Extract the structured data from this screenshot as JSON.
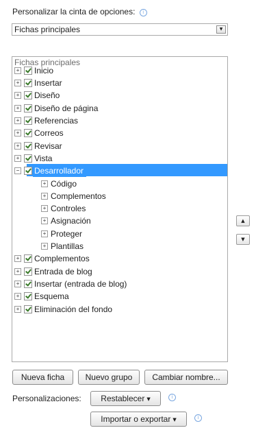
{
  "customize_label": "Personalizar la cinta de opciones:",
  "combo_value": "Fichas principales",
  "tree": {
    "header": "Fichas principales",
    "items": [
      {
        "label": "Inicio",
        "level": 0,
        "expander": "+"
      },
      {
        "label": "Insertar",
        "level": 0,
        "expander": "+"
      },
      {
        "label": "Diseño",
        "level": 0,
        "expander": "+"
      },
      {
        "label": "Diseño de página",
        "level": 0,
        "expander": "+"
      },
      {
        "label": "Referencias",
        "level": 0,
        "expander": "+"
      },
      {
        "label": "Correos",
        "level": 0,
        "expander": "+"
      },
      {
        "label": "Revisar",
        "level": 0,
        "expander": "+"
      },
      {
        "label": "Vista",
        "level": 0,
        "expander": "+"
      },
      {
        "label": "Desarrollador",
        "level": 0,
        "expander": "−",
        "selected": true
      },
      {
        "label": "Código",
        "level": 1,
        "expander": "+"
      },
      {
        "label": "Complementos",
        "level": 1,
        "expander": "+"
      },
      {
        "label": "Controles",
        "level": 1,
        "expander": "+"
      },
      {
        "label": "Asignación",
        "level": 1,
        "expander": "+"
      },
      {
        "label": "Proteger",
        "level": 1,
        "expander": "+"
      },
      {
        "label": "Plantillas",
        "level": 1,
        "expander": "+"
      },
      {
        "label": "Complementos",
        "level": 0,
        "expander": "+"
      },
      {
        "label": "Entrada de blog",
        "level": 0,
        "expander": "+"
      },
      {
        "label": "Insertar (entrada de blog)",
        "level": 0,
        "expander": "+"
      },
      {
        "label": "Esquema",
        "level": 0,
        "expander": "+"
      },
      {
        "label": "Eliminación del fondo",
        "level": 0,
        "expander": "+"
      }
    ]
  },
  "move_up_icon": "triangle-up-icon",
  "move_down_icon": "triangle-down-icon",
  "buttons": {
    "new_tab": "Nueva ficha",
    "new_group": "Nuevo grupo",
    "rename": "Cambiar nombre..."
  },
  "customizations_label": "Personalizaciones:",
  "reset_label": "Restablecer",
  "import_export_label": "Importar o exportar",
  "selection_color": "#3399ff"
}
